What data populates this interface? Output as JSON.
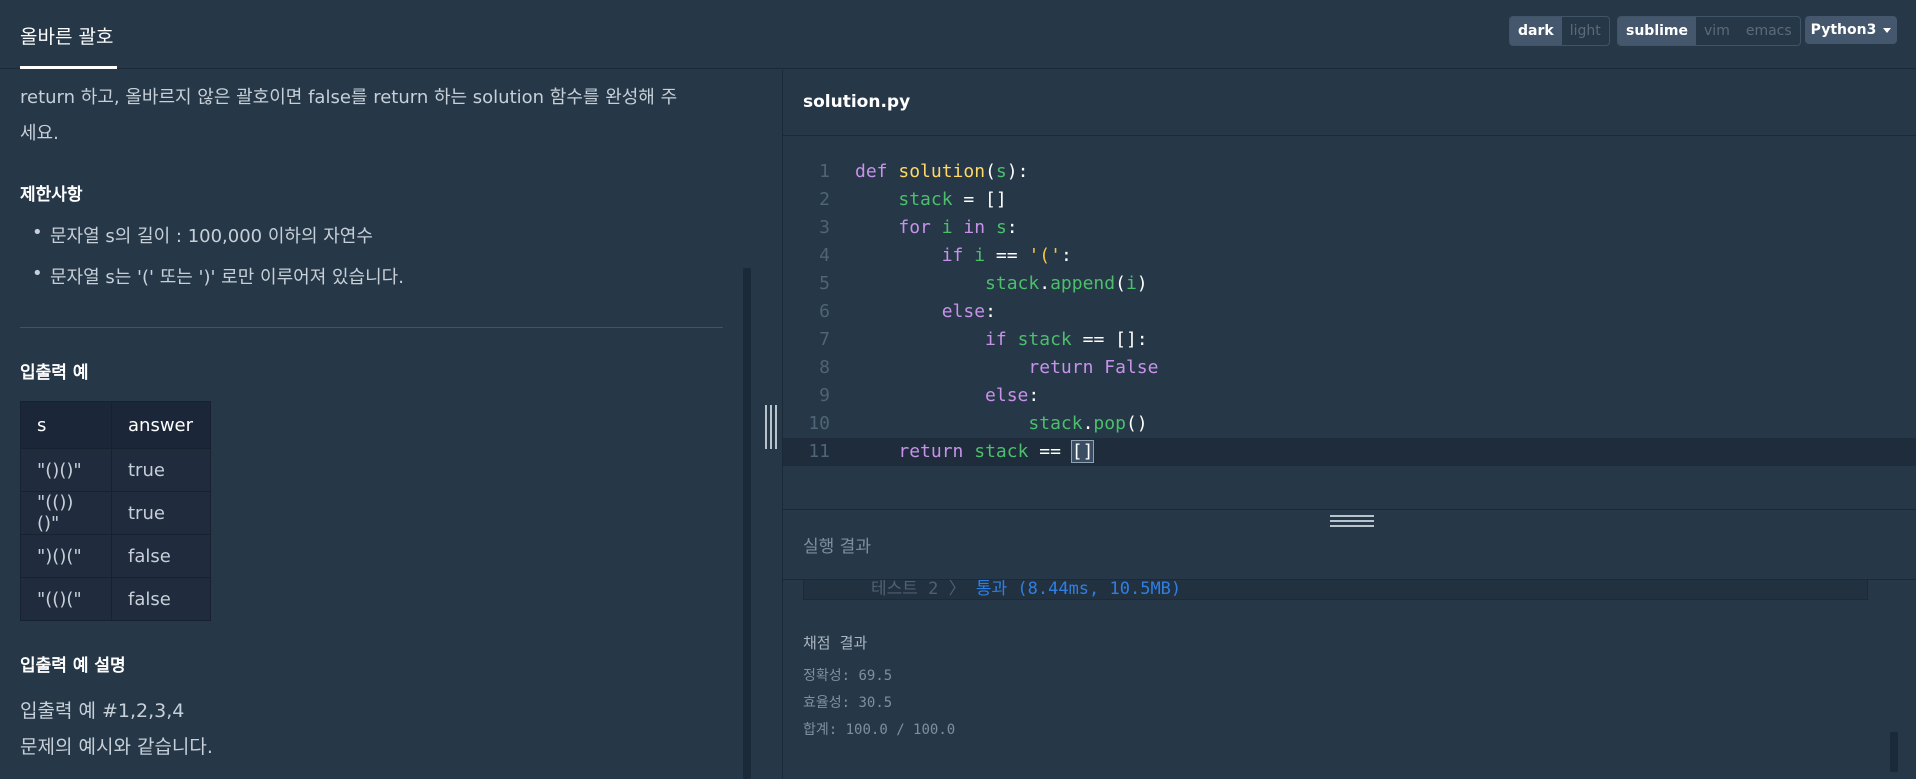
{
  "header": {
    "title": "올바른 괄호",
    "theme": {
      "options": [
        "dark",
        "light"
      ],
      "selected": "dark"
    },
    "keymap": {
      "options": [
        "sublime",
        "vim",
        "emacs"
      ],
      "selected": "sublime"
    },
    "language": "Python3"
  },
  "problem": {
    "description_line1": "return 하고, 올바르지 않은 괄호이면 false를 return 하는 solution 함수를 완성해 주",
    "description_line2": "세요.",
    "constraints_title": "제한사항",
    "constraints": [
      "문자열 s의 길이 : 100,000 이하의 자연수",
      "문자열 s는 '(' 또는 ')' 로만 이루어져 있습니다."
    ],
    "examples_title": "입출력 예",
    "table": {
      "headers": [
        "s",
        "answer"
      ],
      "rows": [
        [
          "\"()()\"",
          "true"
        ],
        [
          "\"(())()\"",
          "true"
        ],
        [
          "\")()(\"",
          "false"
        ],
        [
          "\"(()(\"",
          "false"
        ]
      ]
    },
    "explanation_title": "입출력 예 설명",
    "explanation_line1": "입출력 예 #1,2,3,4",
    "explanation_line2": "문제의 예시와 같습니다."
  },
  "editor": {
    "filename": "solution.py",
    "line_numbers": [
      "1",
      "2",
      "3",
      "4",
      "5",
      "6",
      "7",
      "8",
      "9",
      "10",
      "11"
    ],
    "current_line": 11
  },
  "result": {
    "title": "실행 결과",
    "test_label": "테스트 2 〉",
    "test_result": "통과 (8.44ms, 10.5MB)",
    "grading_title": "채점 결과",
    "accuracy": "정확성: 69.5",
    "efficiency": "효율성: 30.5",
    "total": "합계: 100.0 / 100.0"
  },
  "colors": {
    "background": "#263747",
    "keyword": "#c792ea",
    "function": "#ffd866",
    "variable": "#4bbf6b",
    "pass": "#2f7fe3"
  }
}
